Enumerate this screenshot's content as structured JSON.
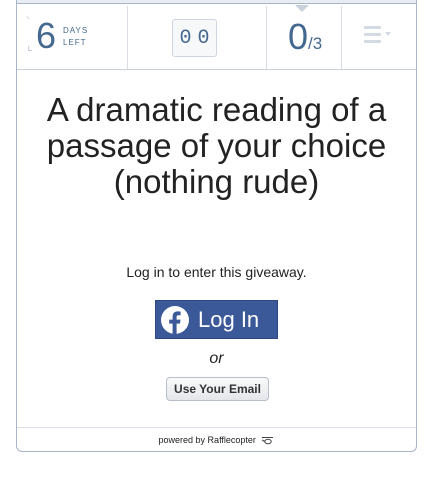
{
  "stats": {
    "days_value": "6",
    "days_label_line1": "DAYS",
    "days_label_line2": "LEFT",
    "entries_digits": [
      "0",
      "0"
    ],
    "score_value": "0",
    "score_total": "/3"
  },
  "prize": {
    "title": "A dramatic reading of a passage of your choice (nothing rude)"
  },
  "login": {
    "prompt": "Log in to enter this giveaway.",
    "facebook_label": "Log In",
    "or_label": "or",
    "email_label": "Use Your Email"
  },
  "footer": {
    "powered_by": "powered by Rafflecopter"
  },
  "colors": {
    "accent": "#44688f",
    "facebook": "#3b5998"
  }
}
